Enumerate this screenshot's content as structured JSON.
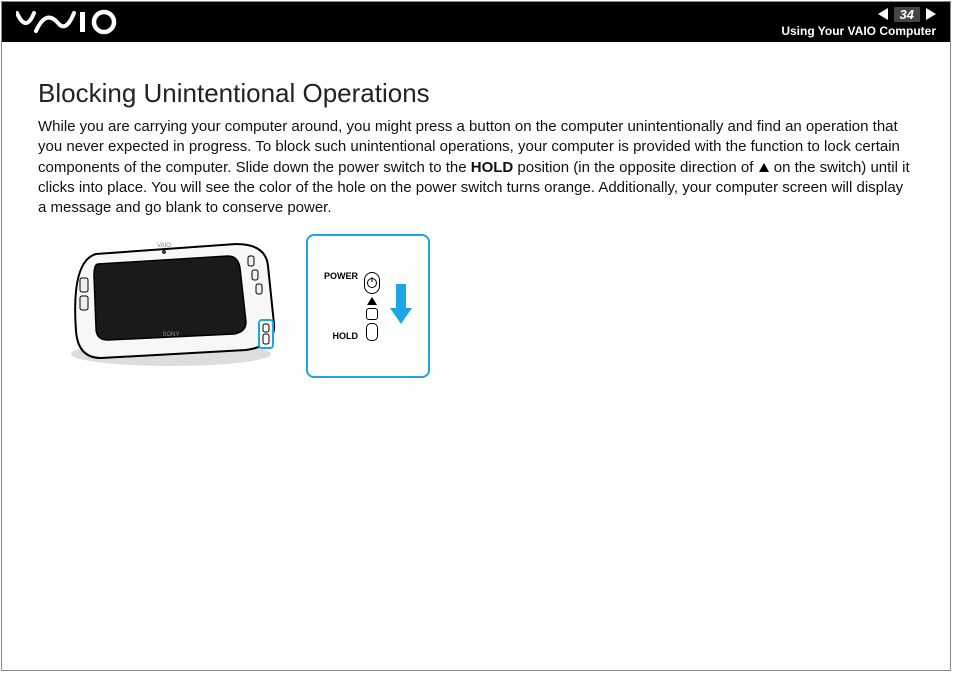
{
  "header": {
    "page_number": "34",
    "section": "Using Your VAIO Computer"
  },
  "content": {
    "title": "Blocking Unintentional Operations",
    "para_part1": "While you are carrying your computer around, you might press a button on the computer unintentionally and find an operation that you never expected in progress. To block such unintentional operations, your computer is provided with the function to lock certain components of the computer. Slide down the power switch to the ",
    "hold_word": "HOLD",
    "para_part2": " position (in the opposite direction of ",
    "para_part3": " on the switch) until it clicks into place. You will see the color of the hole on the power switch turns orange. Additionally, your computer screen will display a message and go blank to conserve power."
  },
  "figure": {
    "label_power": "POWER",
    "label_hold": "HOLD"
  }
}
